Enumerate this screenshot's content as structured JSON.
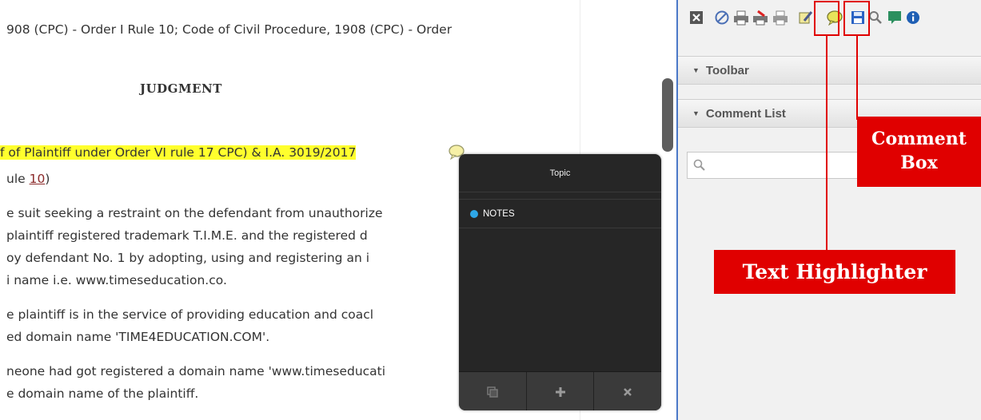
{
  "document": {
    "lines": [
      "908 (CPC) - Order I Rule 10; Code of Civil Procedure, 1908 (CPC) - Order",
      "ule ",
      "e suit seeking a restraint on the defendant from unauthorize",
      "plaintiff registered trademark T.I.M.E. and the registered d",
      "oy defendant No. 1 by adopting, using and registering an i",
      "i name i.e. www.timeseducation.co.",
      "e plaintiff is in the service of providing education and coacl",
      "ed domain name 'TIME4EDUCATION.COM'.",
      "neone had got registered a domain name 'www.timeseducati",
      "e domain name of the plaintiff."
    ],
    "judgment_title": "JUDGMENT",
    "highlighted_text": "f of Plaintiff under Order VI rule 17 CPC) & I.A. 3019/2017",
    "link_text": "10",
    "link_suffix": ")"
  },
  "panel": {
    "toolbar_label": "Toolbar",
    "comment_list_label": "Comment List",
    "search_placeholder": "",
    "toolbar_icons": [
      "close-icon",
      "cancel-icon",
      "print-icon",
      "print-red-icon",
      "print-gray-icon",
      "text-highlighter-icon",
      "comment-box-icon",
      "save-icon",
      "search-icon",
      "comment-list-icon",
      "info-icon"
    ]
  },
  "popup": {
    "title": "Topic",
    "items": [
      {
        "label": "NOTES",
        "color": "#2ea7e8"
      }
    ],
    "footer_buttons": [
      "copy-icon",
      "plus-icon",
      "close-icon"
    ]
  },
  "annotations": {
    "comment_box": "Comment\nBox",
    "text_highlighter": "Text Highlighter",
    "color": "#e00000"
  }
}
